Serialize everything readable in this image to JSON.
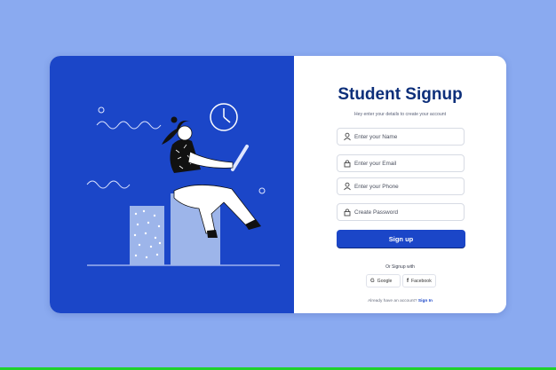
{
  "form": {
    "title": "Student Signup",
    "subtitle": "Hey enter your details to create your account",
    "fields": [
      {
        "placeholder": "Enter your Name",
        "icon": "user-icon"
      },
      {
        "placeholder": "Enter your Email",
        "icon": "lock-icon"
      },
      {
        "placeholder": "Enter your Phone",
        "icon": "user-icon"
      },
      {
        "placeholder": "Create Password",
        "icon": "lock-icon"
      }
    ],
    "signup_label": "Sign up",
    "or_text": "Or Signup with",
    "google_label": "Google",
    "google_glyph": "G",
    "facebook_label": "Facebook",
    "facebook_glyph": "f",
    "signin_prompt": "Already have an account?",
    "signin_link": "Sign In"
  },
  "colors": {
    "background": "#8aaaf0",
    "illustration_bg": "#1b46c8",
    "accent": "#1b46c8",
    "title": "#0d2f7a"
  }
}
